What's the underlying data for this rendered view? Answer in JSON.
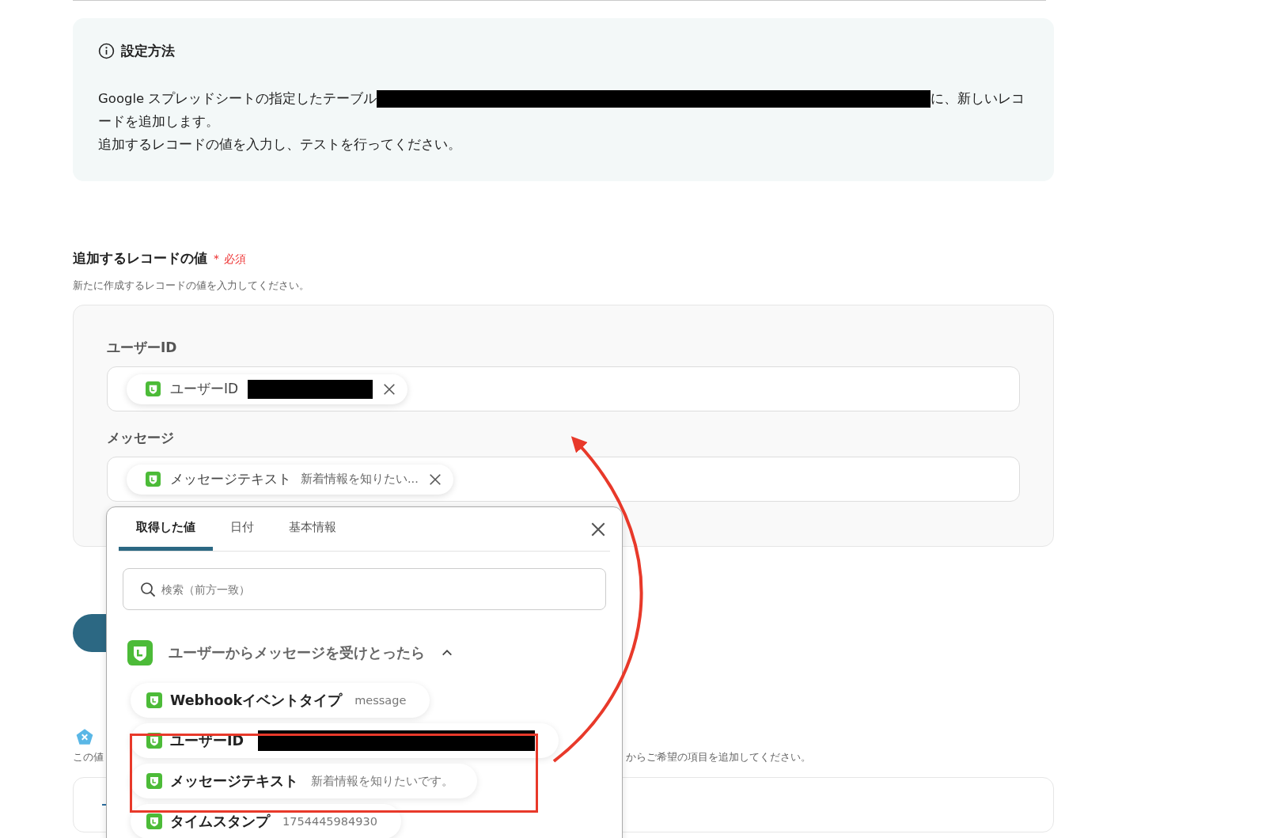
{
  "info_box": {
    "title": "設定方法",
    "lines": [
      {
        "parts": [
          {
            "kind": "text",
            "text": "Google スプレッドシートの指定したテーブル"
          },
          {
            "kind": "redacted"
          },
          {
            "kind": "text",
            "text": "に、新しいレコ"
          }
        ]
      },
      {
        "parts": [
          {
            "kind": "text",
            "text": "ードを追加します。"
          }
        ]
      },
      {
        "parts": [
          {
            "kind": "text",
            "text": "追加するレコードの値を入力し、テストを行ってください。"
          }
        ]
      }
    ]
  },
  "record_section": {
    "title": "追加するレコードの値",
    "required_mark": "＊",
    "required_label": "必須",
    "description": "新たに作成するレコードの値を入力してください。",
    "fields": [
      {
        "label": "ユーザーID",
        "chip": {
          "name": "ユーザーID",
          "redacted": true
        }
      },
      {
        "label": "メッセージ",
        "chip": {
          "name": "メッセージテキスト",
          "value": "新着情報を知りたい...",
          "redacted": false
        }
      }
    ]
  },
  "lower_section": {
    "description_start": "この値",
    "description_end": "からご希望の項目を追加してください。"
  },
  "picker": {
    "tabs": [
      {
        "label": "取得した値",
        "selected": true
      },
      {
        "label": "日付",
        "selected": false
      },
      {
        "label": "基本情報",
        "selected": false
      }
    ],
    "search": {
      "placeholder": "検索（前方一致）"
    },
    "group": {
      "title": "ユーザーからメッセージを受けとったら",
      "expanded": true,
      "items": [
        {
          "name": "Webhookイベントタイプ",
          "value": "message",
          "redacted": false
        },
        {
          "name": "ユーザーID",
          "redacted": true
        },
        {
          "name": "メッセージテキスト",
          "value": "新着情報を知りたいです。",
          "redacted": false
        },
        {
          "name": "タイムスタンプ",
          "value": "1754445984930",
          "redacted": false
        }
      ]
    }
  }
}
